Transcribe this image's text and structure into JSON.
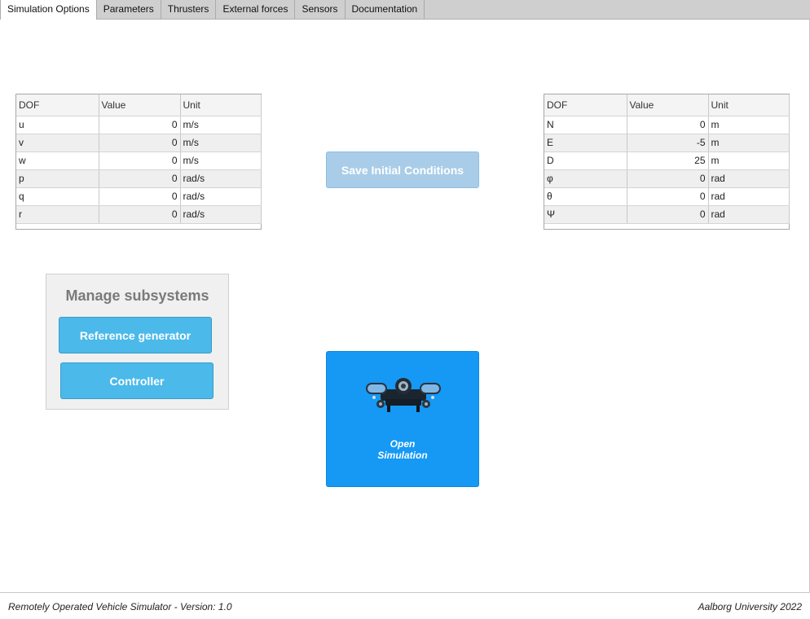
{
  "tabs": [
    {
      "label": "Simulation Options"
    },
    {
      "label": "Parameters"
    },
    {
      "label": "Thrusters"
    },
    {
      "label": "External forces"
    },
    {
      "label": "Sensors"
    },
    {
      "label": "Documentation"
    }
  ],
  "velocity_table": {
    "headers": [
      "DOF",
      "Value",
      "Unit"
    ],
    "rows": [
      {
        "dof": "u",
        "value": "0",
        "unit": "m/s"
      },
      {
        "dof": "v",
        "value": "0",
        "unit": "m/s"
      },
      {
        "dof": "w",
        "value": "0",
        "unit": "m/s"
      },
      {
        "dof": "p",
        "value": "0",
        "unit": "rad/s"
      },
      {
        "dof": "q",
        "value": "0",
        "unit": "rad/s"
      },
      {
        "dof": "r",
        "value": "0",
        "unit": "rad/s"
      }
    ]
  },
  "position_table": {
    "headers": [
      "DOF",
      "Value",
      "Unit"
    ],
    "rows": [
      {
        "dof": "N",
        "value": "0",
        "unit": "m"
      },
      {
        "dof": "E",
        "value": "-5",
        "unit": "m"
      },
      {
        "dof": "D",
        "value": "25",
        "unit": "m"
      },
      {
        "dof": "φ",
        "value": "0",
        "unit": "rad"
      },
      {
        "dof": "θ",
        "value": "0",
        "unit": "rad"
      },
      {
        "dof": "Ψ",
        "value": "0",
        "unit": "rad"
      }
    ]
  },
  "save_button": {
    "label": "Save Initial Conditions"
  },
  "subsystems": {
    "title": "Manage subsystems",
    "reference_button": "Reference generator",
    "controller_button": "Controller"
  },
  "open_simulation": {
    "line1": "Open",
    "line2": "Simulation",
    "icon": "rov-icon"
  },
  "footer": {
    "left": "Remotely Operated Vehicle Simulator - Version: 1.0",
    "right": "Aalborg University 2022"
  },
  "colors": {
    "save_disabled": "#a9cde8",
    "subsystem_button": "#4bb9ea",
    "open_sim": "#1599f5"
  }
}
